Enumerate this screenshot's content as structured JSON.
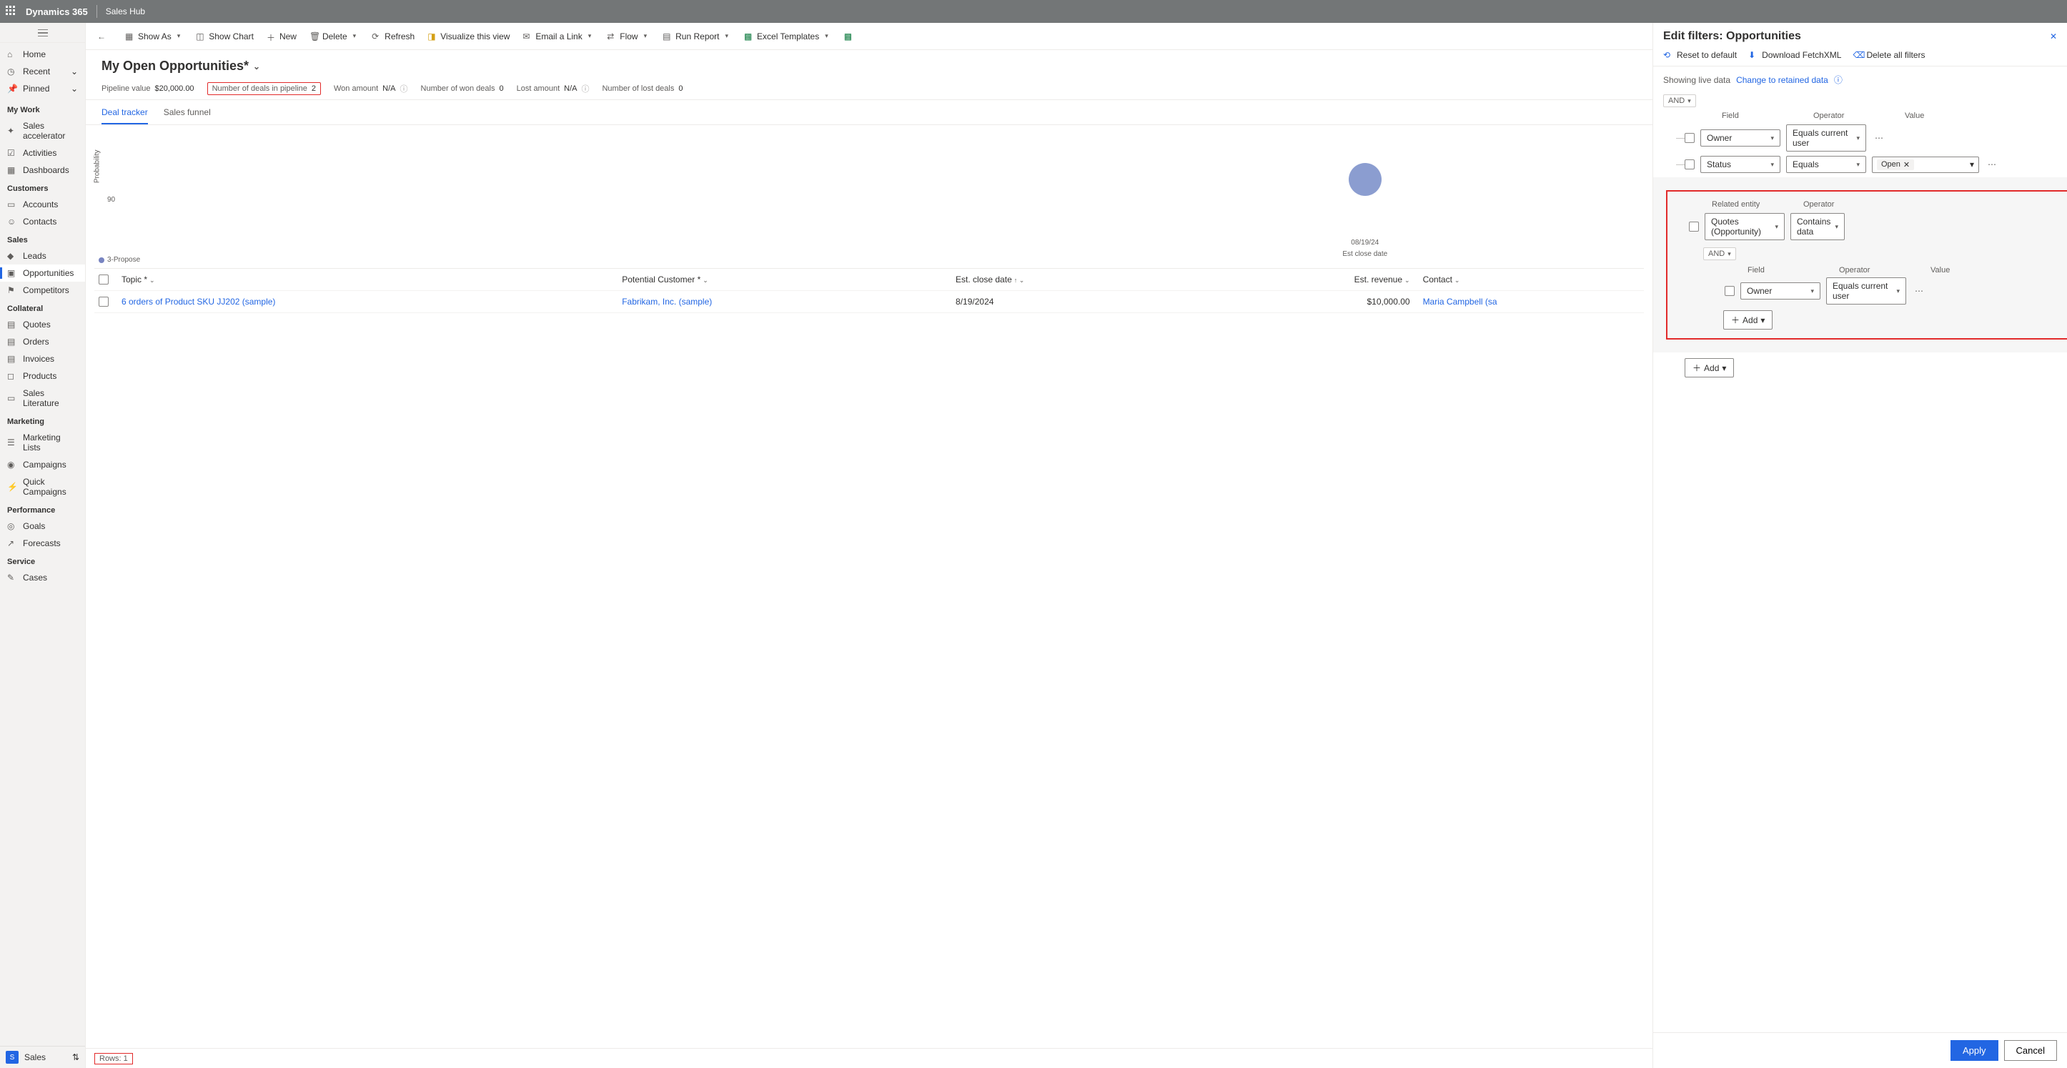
{
  "topbar": {
    "product": "Dynamics 365",
    "app": "Sales Hub"
  },
  "nav": {
    "home": "Home",
    "recent": "Recent",
    "pinned": "Pinned",
    "mywork": "My Work",
    "accel": "Sales accelerator",
    "activities": "Activities",
    "dash": "Dashboards",
    "customers": "Customers",
    "accounts": "Accounts",
    "contacts": "Contacts",
    "sales": "Sales",
    "leads": "Leads",
    "opps": "Opportunities",
    "comp": "Competitors",
    "collateral": "Collateral",
    "quotes": "Quotes",
    "orders": "Orders",
    "invoices": "Invoices",
    "products": "Products",
    "saleslit": "Sales Literature",
    "marketing": "Marketing",
    "mlists": "Marketing Lists",
    "campaigns": "Campaigns",
    "quickcamp": "Quick Campaigns",
    "performance": "Performance",
    "goals": "Goals",
    "forecasts": "Forecasts",
    "service": "Service",
    "cases": "Cases",
    "footer_badge": "S",
    "footer_label": "Sales"
  },
  "cmd": {
    "back": "",
    "showas": "Show As",
    "showchart": "Show Chart",
    "new": "New",
    "delete": "Delete",
    "refresh": "Refresh",
    "visualize": "Visualize this view",
    "email": "Email a Link",
    "flow": "Flow",
    "runreport": "Run Report",
    "excel": "Excel Templates"
  },
  "view": {
    "title": "My Open Opportunities*"
  },
  "pipeline": {
    "pv_label": "Pipeline value",
    "pv_val": "$20,000.00",
    "ndeals_label": "Number of deals in pipeline",
    "ndeals_val": "2",
    "won_amt_label": "Won amount",
    "won_amt_val": "N/A",
    "nwon_label": "Number of won deals",
    "nwon_val": "0",
    "lost_amt_label": "Lost amount",
    "lost_amt_val": "N/A",
    "nlost_label": "Number of lost deals",
    "nlost_val": "0"
  },
  "tabs": {
    "deal": "Deal tracker",
    "funnel": "Sales funnel"
  },
  "chart": {
    "ylabel": "Probability",
    "ytick": "90",
    "xdate": "08/19/24",
    "xlabel": "Est close date",
    "legend": "3-Propose"
  },
  "cols": {
    "topic": "Topic *",
    "cust": "Potential Customer *",
    "date": "Est. close date",
    "rev": "Est. revenue",
    "contact": "Contact"
  },
  "row1": {
    "topic": "6 orders of Product SKU JJ202 (sample)",
    "cust": "Fabrikam, Inc. (sample)",
    "date": "8/19/2024",
    "rev": "$10,000.00",
    "contact": "Maria Campbell (sa"
  },
  "status": {
    "rows_label": "Rows: 1"
  },
  "panel": {
    "title": "Edit filters: Opportunities",
    "reset": "Reset to default",
    "fetchxml": "Download FetchXML",
    "deleteall": "Delete all filters",
    "live": "Showing live data",
    "retained": "Change to retained data",
    "and": "AND",
    "h_field": "Field",
    "h_operator": "Operator",
    "h_value": "Value",
    "f1_field": "Owner",
    "f1_op": "Equals current user",
    "f2_field": "Status",
    "f2_op": "Equals",
    "f2_val": "Open",
    "rel_label": "Related entity",
    "rel_op_label": "Operator",
    "rel_entity": "Quotes (Opportunity)",
    "rel_op": "Contains data",
    "nested_field": "Owner",
    "nested_op": "Equals current user",
    "add": "Add",
    "apply": "Apply",
    "cancel": "Cancel"
  }
}
